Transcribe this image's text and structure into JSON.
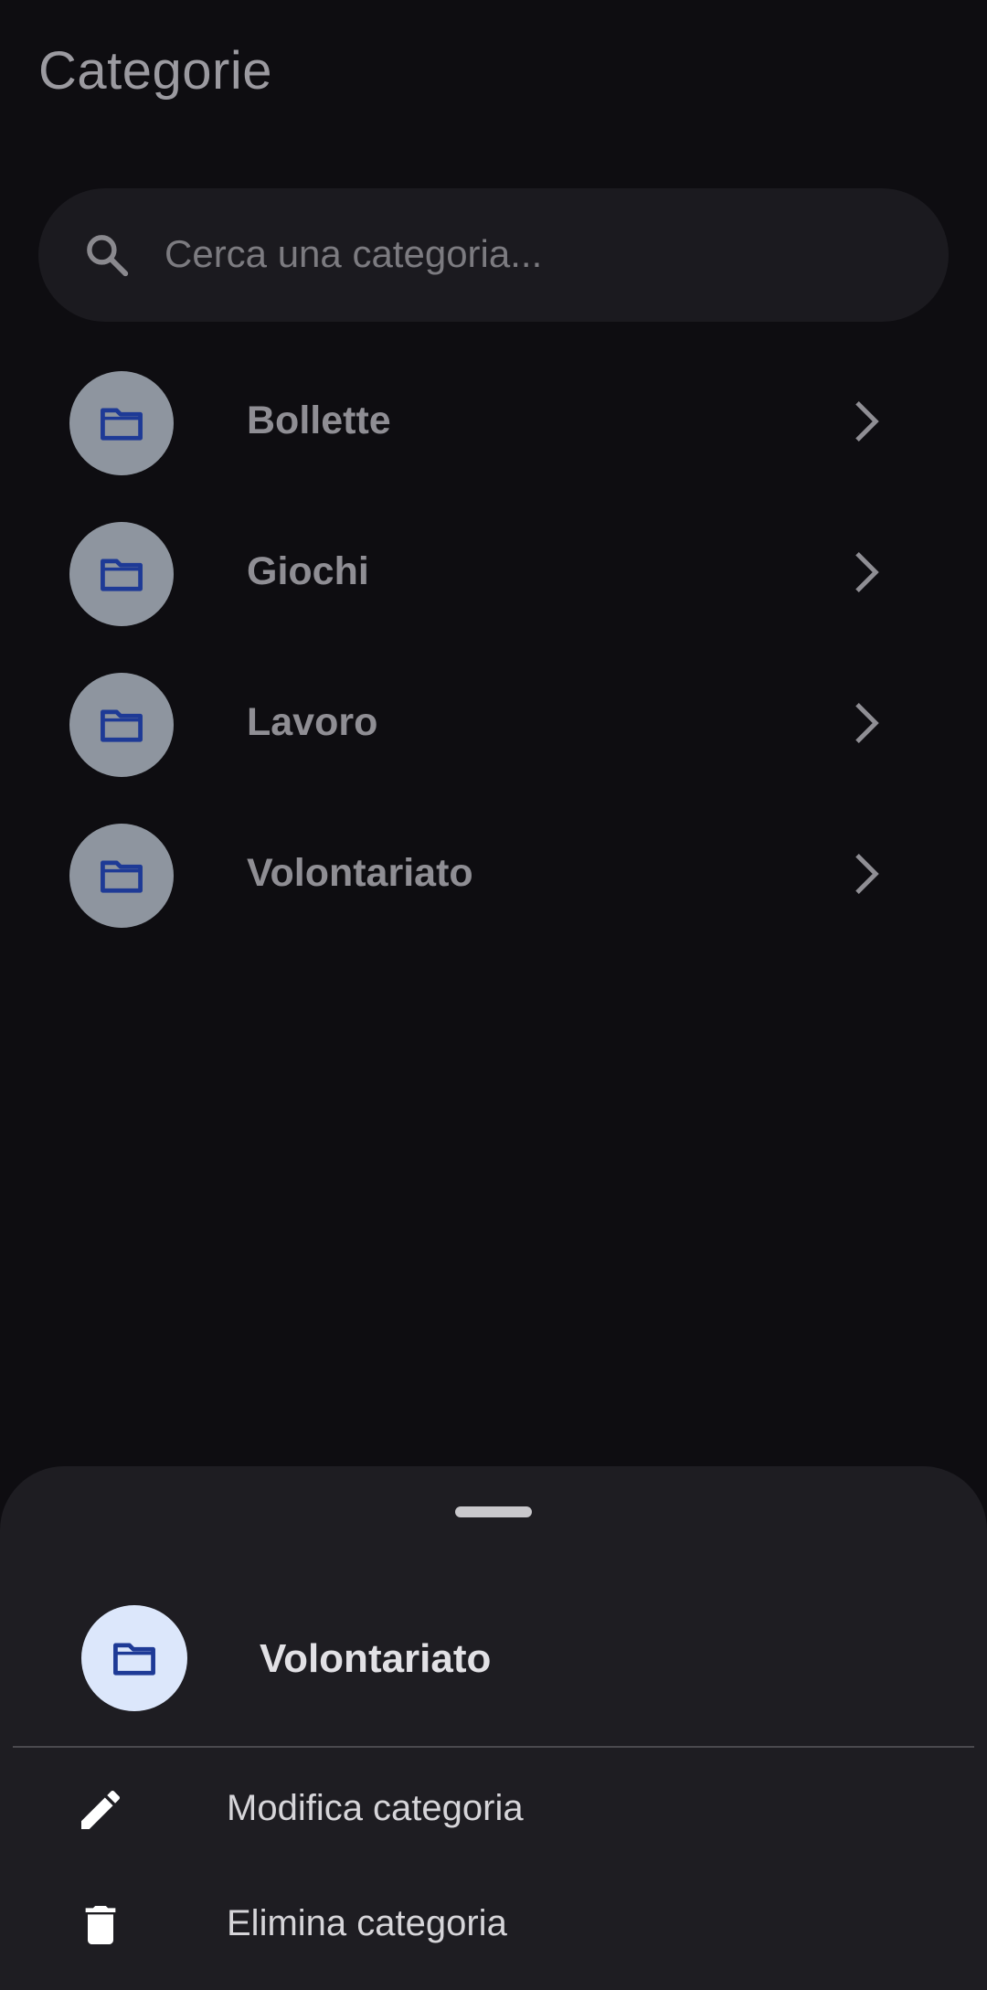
{
  "header": {
    "title": "Categorie"
  },
  "search": {
    "placeholder": "Cerca una categoria..."
  },
  "categories": [
    {
      "label": "Bollette"
    },
    {
      "label": "Giochi"
    },
    {
      "label": "Lavoro"
    },
    {
      "label": "Volontariato"
    }
  ],
  "sheet": {
    "title": "Volontariato",
    "actions": [
      {
        "label": "Modifica categoria",
        "icon": "pencil-icon"
      },
      {
        "label": "Elimina categoria",
        "icon": "trash-icon"
      }
    ]
  },
  "colors": {
    "background": "#0e0d11",
    "folder_icon": "#1e3a96",
    "sheet_background": "#1e1d22"
  }
}
